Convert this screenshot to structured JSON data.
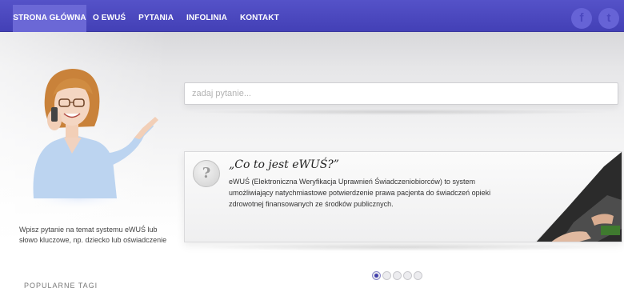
{
  "nav": {
    "items": [
      {
        "label": "STRONA GŁÓWNA"
      },
      {
        "label": "O EWUŚ"
      },
      {
        "label": "PYTANIA"
      },
      {
        "label": "INFOLINIA"
      },
      {
        "label": "KONTAKT"
      }
    ],
    "active": "STRONA GŁÓWNA"
  },
  "social": {
    "facebook_glyph": "f",
    "twitter_glyph": "t"
  },
  "left": {
    "helper_text": "Wpisz pytanie na temat systemu eWUŚ lub słowo kluczowe, np. dziecko lub oświadczenie",
    "tags_label": "POPULARNE TAGI"
  },
  "search": {
    "placeholder": "zadaj pytanie...",
    "value": ""
  },
  "card": {
    "badge": "?",
    "title": "„Co to jest eWUŚ?”",
    "body": "eWUŚ (Elektroniczna Weryfikacja Uprawnień Świadczeniobiorców) to system umożliwiający natychmiastowe potwierdzenie prawa pacjenta do świadczeń opieki zdrowotnej finansowanych ze środków publicznych."
  },
  "carousel": {
    "count": 5,
    "active_index": 0
  },
  "colors": {
    "nav_bg": "#4a47bd",
    "nav_active": "#6b68d6"
  }
}
